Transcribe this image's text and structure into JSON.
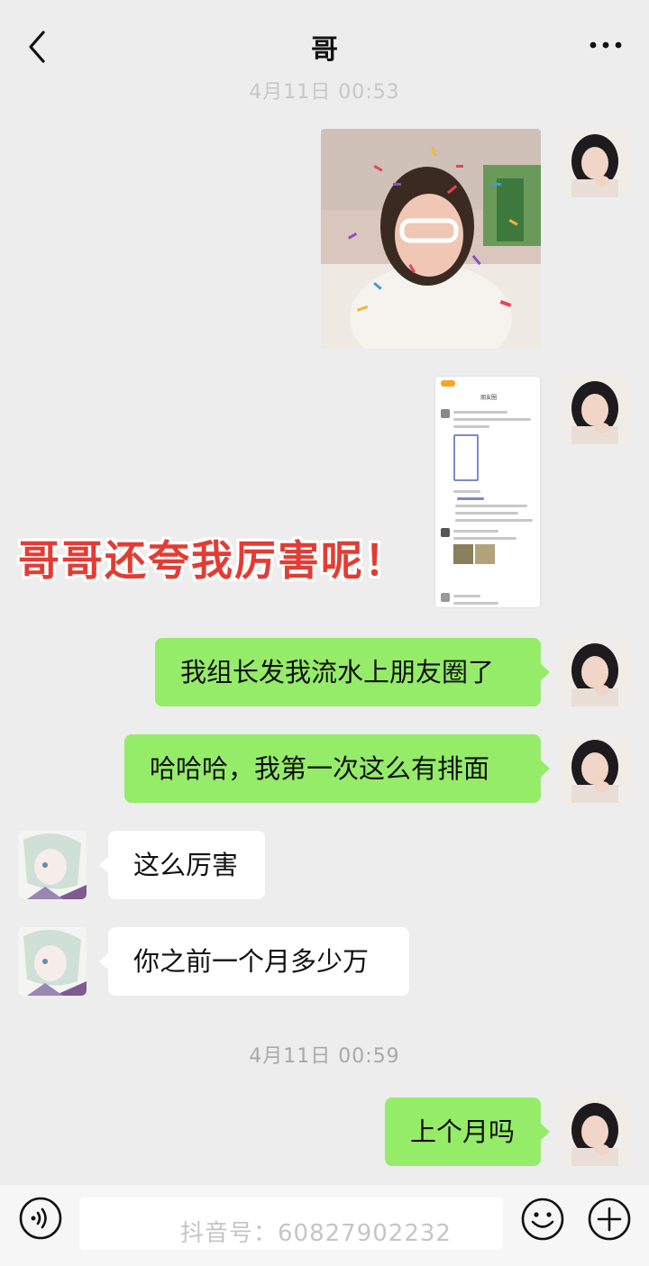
{
  "header": {
    "title": "哥",
    "back_icon": "chevron-left-icon",
    "more_icon": "more-dots-icon"
  },
  "timestamps": [
    "4月11日 00:53",
    "4月11日 00:59"
  ],
  "overlay_caption": "哥哥还夸我厉害呢！",
  "screenshot_card": {
    "title": "朋友圈"
  },
  "messages": [
    {
      "from": "me",
      "type": "image"
    },
    {
      "from": "me",
      "type": "screenshot"
    },
    {
      "from": "me",
      "text": "我组长发我流水上朋友圈了"
    },
    {
      "from": "me",
      "text": "哈哈哈，我第一次这么有排面"
    },
    {
      "from": "other",
      "text": "这么厉害"
    },
    {
      "from": "other",
      "text": "你之前一个月多少万"
    },
    {
      "from": "me",
      "text": "上个月吗"
    }
  ],
  "input_bar": {
    "voice_icon": "voice-icon",
    "emoji_icon": "emoji-icon",
    "plus_icon": "plus-icon"
  },
  "watermark": "抖音号：60827902232",
  "colors": {
    "bubble_me": "#95ec69",
    "bubble_other": "#ffffff",
    "background": "#ededed",
    "caption": "#e33c34"
  }
}
